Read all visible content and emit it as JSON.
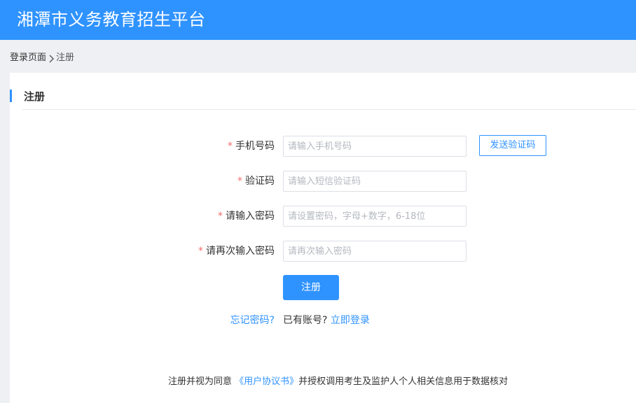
{
  "header": {
    "title": "湘潭市义务教育招生平台"
  },
  "breadcrumb": {
    "home": "登录页面",
    "current": "注册"
  },
  "section": {
    "title": "注册"
  },
  "form": {
    "required_mark": "*",
    "phone": {
      "label": "手机号码",
      "placeholder": "请输入手机号码",
      "value": ""
    },
    "code": {
      "label": "验证码",
      "placeholder": "请输入短信验证码",
      "value": ""
    },
    "password": {
      "label": "请输入密码",
      "placeholder": "请设置密码，字母+数字，6-18位",
      "value": ""
    },
    "confirm": {
      "label": "请再次输入密码",
      "placeholder": "请再次输入密码",
      "value": ""
    },
    "send_code_label": "发送验证码",
    "submit_label": "注册"
  },
  "links": {
    "forgot": "忘记密码?",
    "have_account": "已有账号?",
    "login_now": "立即登录"
  },
  "agreement": {
    "prefix": "注册并视为同意",
    "link": "《用户协议书》",
    "suffix": "并授权调用考生及监护人个人相关信息用于数据核对"
  },
  "colors": {
    "primary": "#2f93ff",
    "required": "#f56c6c",
    "background": "#eef0f3"
  },
  "icons": {
    "breadcrumb_separator": "chevron-right-icon"
  }
}
